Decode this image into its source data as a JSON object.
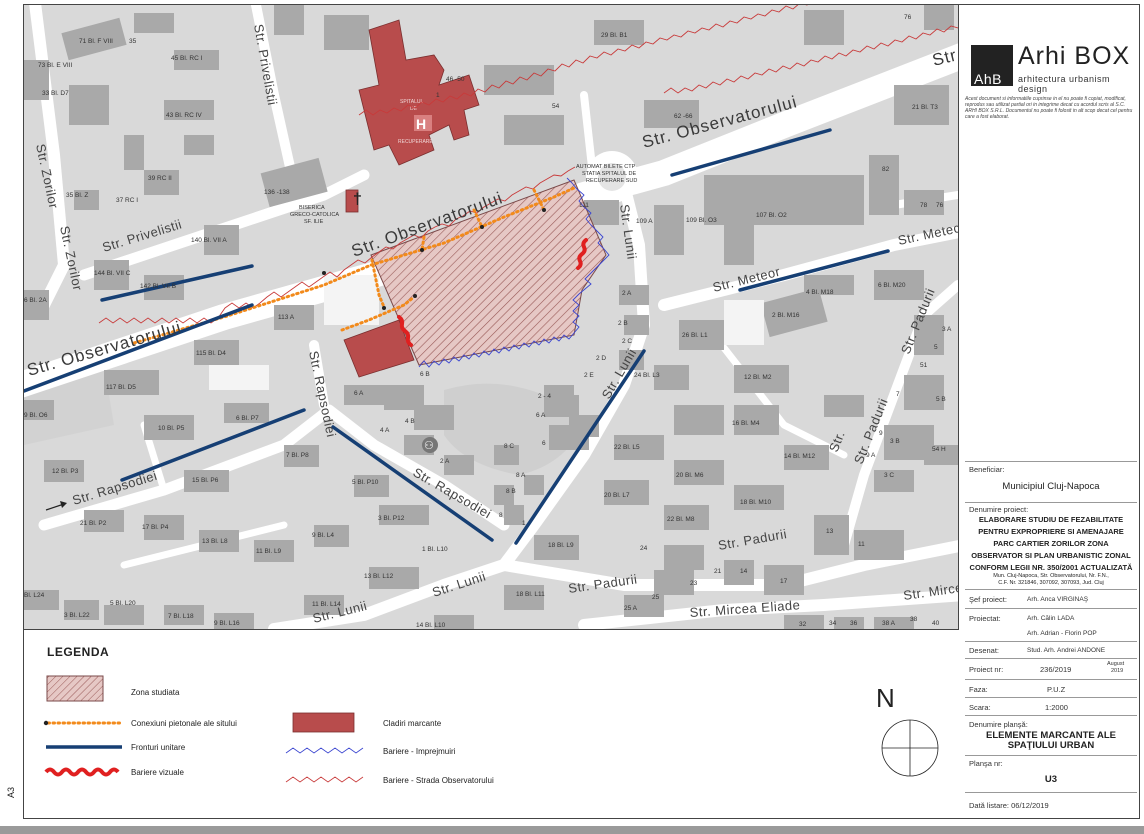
{
  "sheet": {
    "size_tag": "A3"
  },
  "map": {
    "streets": {
      "observatorului": "Str. Observatorului",
      "zorilor": "Str. Zorilor",
      "privelistii": "Str. Privelistii",
      "privelistii_top": "Str. Privelistii",
      "lunii": "Str. Lunii",
      "meteor": "Str. Meteor",
      "metec": "Str. Metec",
      "padurii": "Str. Padurii",
      "rapsodiei": "Str. Rapsodiei",
      "mircea_eliade": "Str. Mircea Eliade",
      "mircea": "Str. Mircea",
      "str": "Str",
      "sti": "Str."
    },
    "buildings": {
      "b1": "71 Bl. F VIII",
      "b2": "35",
      "b3": "45 Bl. RC I",
      "b4": "73 Bl. E VIII",
      "b5": "33 Bl. D7",
      "b6": "43 Bl. RC IV",
      "b7": "39 RC II",
      "b8": "35 Bl. Z",
      "b9": "37 RC I",
      "b10": "136 -138",
      "b11": "140 Bl. VII A",
      "b12": "144 Bl. VII C",
      "b13": "142 Bl. VII B",
      "b14": "6 Bl. 2A",
      "b15": "113 A",
      "b16": "115 Bl. D4",
      "b17": "117 Bl. D5",
      "b18": "9 Bl. O6",
      "b19": "10 Bl. P5",
      "b20": "6 Bl. P7",
      "b21": "7 Bl. P8",
      "b22": "12 Bl. P3",
      "b23": "15 Bl. P6",
      "b24": "5 Bl. P10",
      "b25": "21 Bl. P2",
      "b26": "17 Bl. P4",
      "b27": "3 Bl. P12",
      "b28": "13 Bl. L8",
      "b29": "11 Bl. L9",
      "b30": "9 Bl. L4",
      "b31": "1 Bl. L10",
      "b32": "13 Bl. L12",
      "b33": "11 Bl. L14",
      "b34": "Bl. L24",
      "b35": "3 Bl. L22",
      "b36": "5 Bl. L20",
      "b37": "7 Bl. L18",
      "b38": "9 Bl. L16",
      "b39": "14 Bl. L10",
      "b40": "18 Bl. L11",
      "b41": "18 Bl. L9",
      "b42": "29 Bl. B1",
      "b43": "46 -50",
      "b44": "54",
      "b45": "62 -66",
      "b46": "76",
      "b47": "21 Bl. T3",
      "b48": "111",
      "b49": "109 A",
      "b50": "109 Bl. O3",
      "b51": "107 Bl. O2",
      "b52": "82",
      "b53": "78",
      "b54": "76",
      "b55": "2 A",
      "b56": "2 B",
      "b57": "2 C",
      "b58": "2 D",
      "b59": "2 E",
      "b60": "26 Bl. L1",
      "b61": "24 Bl. L3",
      "b62": "4 Bl. M18",
      "b63": "2 Bl. M16",
      "b64": "6 Bl. M20",
      "b65": "12 Bl. M2",
      "b66": "16 Bl. M4",
      "b67": "14 Bl. M12",
      "b68": "22 Bl. L5",
      "b69": "20 Bl. M6",
      "b70": "20 Bl. L7",
      "b71": "18 Bl. M10",
      "b72": "22 Bl. M8",
      "b73": "6 B",
      "b74": "6 A",
      "b75": "4 B",
      "b76": "4 A",
      "b77": "2 - 4",
      "b78": "6 A",
      "b79": "8 C",
      "b80": "6",
      "b81": "2 A",
      "b82": "8 A",
      "b83": "8 B",
      "b84": "8",
      "b85": "24",
      "b86": "13",
      "b87": "11",
      "b88": "23",
      "b89": "21",
      "b90": "14",
      "b91": "17",
      "b92": "25 A",
      "b93": "25",
      "b94": "32",
      "b95": "34",
      "b96": "36",
      "b97": "38 A",
      "b98": "38",
      "b99": "40",
      "b100": "3 A",
      "b101": "5",
      "b102": "51",
      "b103": "5 B",
      "b104": "7",
      "b105": "9",
      "b106": "3 B",
      "b107": "9 A",
      "b108": "3 C",
      "b109": "54 H",
      "b110": "1",
      "b111": "1"
    },
    "landmarks": {
      "hospital_mark": "H",
      "hospital_l1": "SPITALUL",
      "hospital_l2": "DE",
      "hospital_l3": "RECUPERARE",
      "church_l1": "BISERICA",
      "church_l2": "GRECO-CATOLICA",
      "church_l3": "SF. ILIE",
      "cross": "†",
      "auto_l1": "AUTOMAT BILETE CTP",
      "auto_l2": "STATIA SPITALUL DE",
      "auto_l3": "RECUPERARE SUD",
      "sports_mark": "⚇"
    }
  },
  "legend": {
    "title": "LEGENDA",
    "items": {
      "zona": "Zona studiata",
      "conexiuni": "Conexiuni pietonale ale sitului",
      "fronturi": "Fronturi unitare",
      "vizuale": "Bariere vizuale",
      "cladiri": "Cladiri marcante",
      "imprejmuiri": "Bariere - Imprejmuiri",
      "strada": "Bariere - Strada Observatorului"
    },
    "north": "N"
  },
  "colors": {
    "study_zone": "#b98383",
    "landmark": "#b84c4c",
    "pedestrian": "#f28a1b",
    "front": "#163f74",
    "visual_barrier": "#e02020",
    "fence": "#3a45d0",
    "street_barrier": "#c83a3a",
    "building": "#a9a9a9",
    "road": "#ffffff"
  },
  "title_block": {
    "logo_mark": "AhB",
    "logo_name": "Arhi BOX",
    "logo_sub": "arhitectura urbanism design",
    "disclaimer": "Acest document si informatiile cuprinse in el nu poate fi copiat, modificat, reprodus sau utilizat partial ori in integrime decat cu acordul scris al S.C. ARHI BOX S.R.L. Documentul nu poate fi folosit in alt scop decat cel pentru care a fost elaborat.",
    "beneficiar_label": "Beneficiar:",
    "beneficiar": "Municipiul Cluj-Napoca",
    "denumire_label": "Denumire proiect:",
    "project_l1": "ELABORARE STUDIU DE FEZABILITATE",
    "project_l2": "PENTRU EXPROPRIERE SI AMENAJARE",
    "project_l3": "PARC CARTIER ZORILOR ZONA",
    "project_l4": "OBSERVATOR SI PLAN URBANISTIC ZONAL",
    "project_l5": "CONFORM LEGII NR. 350/2001 ACTUALIZATĂ",
    "address_l1": "Mun. Cluj-Napoca, Str. Observatorului, Nr. F.N.,",
    "address_l2": "C.F. Nr. 321846, 307092, 307093, Jud. Cluj",
    "sef_label": "Şef proiect:",
    "sef": "Arh. Anca VIRGINAŞ",
    "proiectat_label": "Proiectat:",
    "proiectat1": "Arh. Călin LADA",
    "proiectat2": "Arh. Adrian - Florin POP",
    "desenat_label": "Desenat:",
    "desenat": "Stud. Arh. Andrei ANDONE",
    "proiect_nr_label": "Proiect nr:",
    "proiect_nr": "236/2019",
    "date_l1": "August",
    "date_l2": "2019",
    "faza_label": "Faza:",
    "faza": "P.U.Z",
    "scara_label": "Scara:",
    "scara": "1:2000",
    "plansa_label": "Denumire planşă:",
    "plansa_l1": "ELEMENTE MARCANTE ALE",
    "plansa_l2": "SPAŢIULUI URBAN",
    "plansa_nr_label": "Planşa nr:",
    "plansa_nr": "U3",
    "data_listare": "Dată listare: 06/12/2019"
  }
}
